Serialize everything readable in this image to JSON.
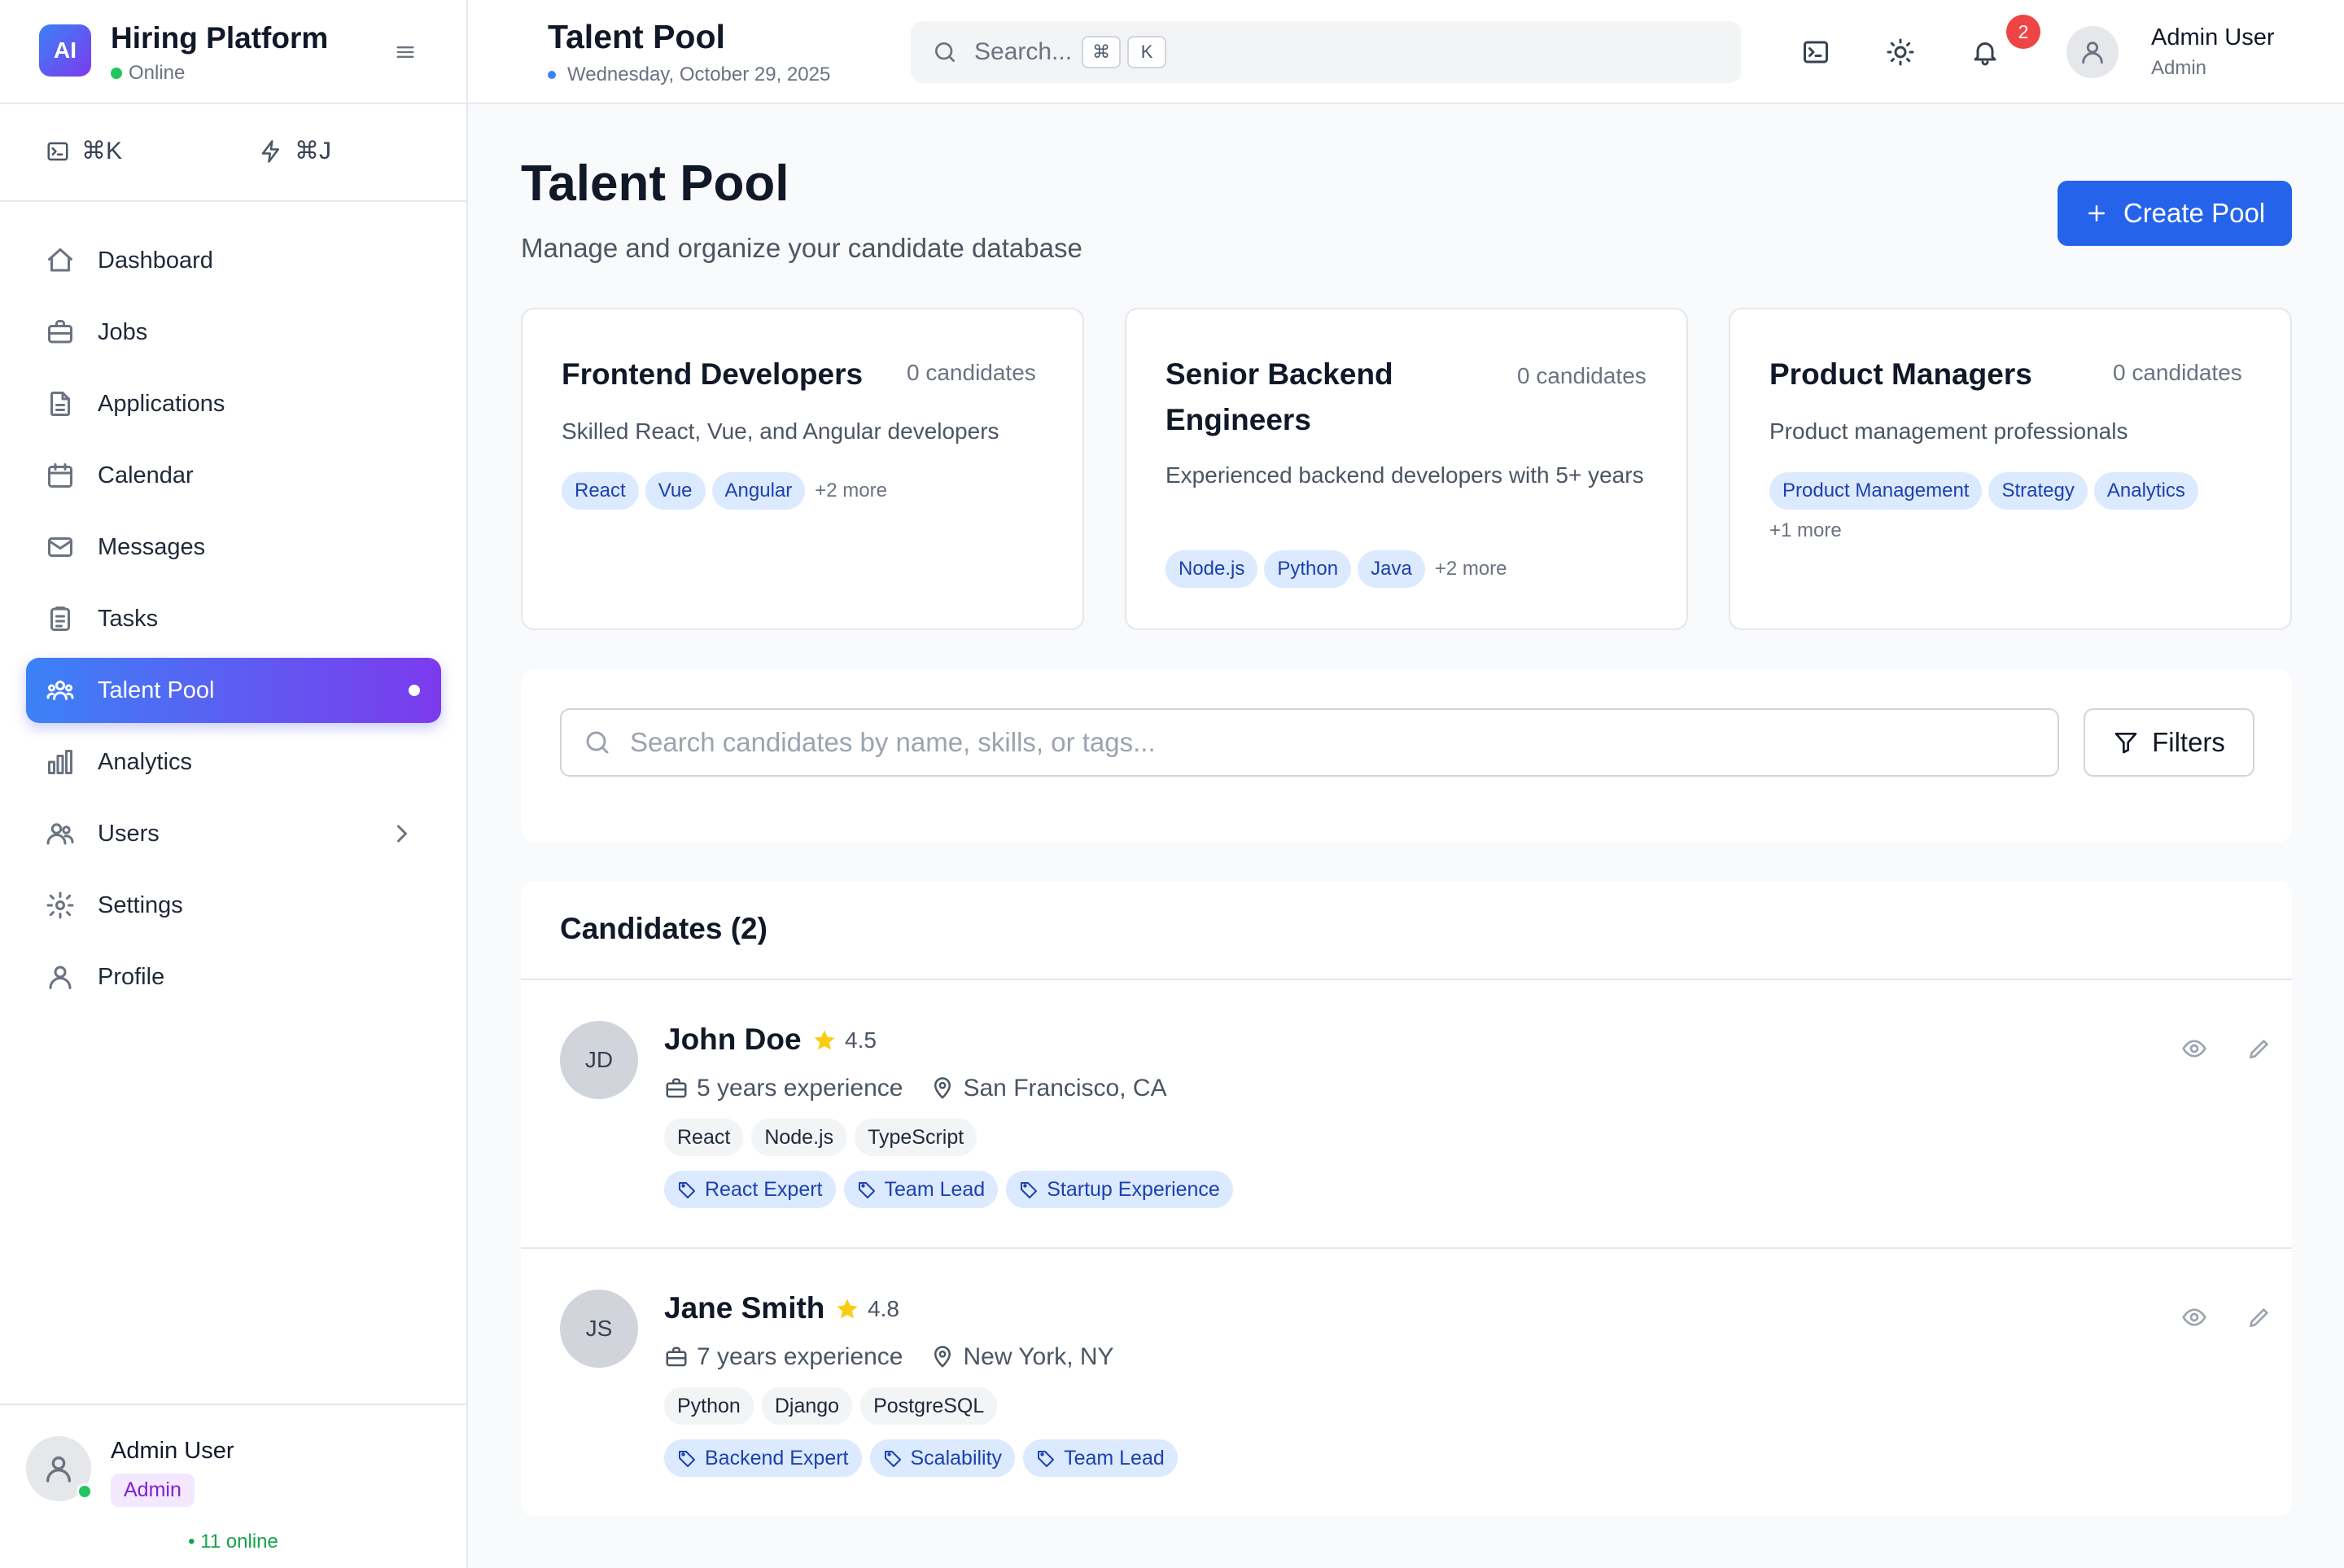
{
  "brand": {
    "logo_text": "AI",
    "name": "Hiring Platform",
    "status": "Online"
  },
  "shortcuts": [
    {
      "icon": "terminal-icon",
      "label": "⌘K"
    },
    {
      "icon": "lightning-icon",
      "label": "⌘J"
    }
  ],
  "nav": [
    {
      "label": "Dashboard",
      "icon": "home-icon"
    },
    {
      "label": "Jobs",
      "icon": "briefcase-icon"
    },
    {
      "label": "Applications",
      "icon": "document-icon"
    },
    {
      "label": "Calendar",
      "icon": "calendar-icon"
    },
    {
      "label": "Messages",
      "icon": "mail-icon"
    },
    {
      "label": "Tasks",
      "icon": "clipboard-icon"
    },
    {
      "label": "Talent Pool",
      "icon": "users-group-icon",
      "active": true
    },
    {
      "label": "Analytics",
      "icon": "bar-chart-icon"
    },
    {
      "label": "Users",
      "icon": "users-icon",
      "has_submenu": true
    },
    {
      "label": "Settings",
      "icon": "gear-icon"
    },
    {
      "label": "Profile",
      "icon": "user-icon"
    }
  ],
  "sidebar_footer": {
    "name": "Admin User",
    "role": "Admin",
    "online_text": "11 online"
  },
  "topbar": {
    "title": "Talent Pool",
    "date": "Wednesday, October 29, 2025",
    "search_placeholder": "Search...",
    "search_keys": [
      "⌘",
      "K"
    ],
    "notification_count": "2",
    "user_name": "Admin User",
    "user_role": "Admin"
  },
  "page": {
    "title": "Talent Pool",
    "subtitle": "Manage and organize your candidate database",
    "create_button": "Create Pool"
  },
  "pools": [
    {
      "title": "Frontend Developers",
      "count": "0 candidates",
      "description": "Skilled React, Vue, and Angular developers",
      "tags": [
        "React",
        "Vue",
        "Angular"
      ],
      "more": "+2 more"
    },
    {
      "title": "Senior Backend Engineers",
      "count": "0 candidates",
      "description": "Experienced backend developers with 5+ years",
      "tags": [
        "Node.js",
        "Python",
        "Java"
      ],
      "more": "+2 more"
    },
    {
      "title": "Product Managers",
      "count": "0 candidates",
      "description": "Product management professionals",
      "tags": [
        "Product Management",
        "Strategy",
        "Analytics"
      ],
      "more": "+1 more"
    }
  ],
  "candidate_search": {
    "placeholder": "Search candidates by name, skills, or tags...",
    "filters_label": "Filters"
  },
  "candidates_section": {
    "title": "Candidates (2)",
    "items": [
      {
        "initials": "JD",
        "name": "John Doe",
        "rating": "4.5",
        "experience": "5 years experience",
        "location": "San Francisco, CA",
        "skills": [
          "React",
          "Node.js",
          "TypeScript"
        ],
        "labels": [
          "React Expert",
          "Team Lead",
          "Startup Experience"
        ]
      },
      {
        "initials": "JS",
        "name": "Jane Smith",
        "rating": "4.8",
        "experience": "7 years experience",
        "location": "New York, NY",
        "skills": [
          "Python",
          "Django",
          "PostgreSQL"
        ],
        "labels": [
          "Backend Expert",
          "Scalability",
          "Team Lead"
        ]
      }
    ]
  },
  "colors": {
    "primary": "#2563eb",
    "active_gradient_start": "#3b82f6",
    "active_gradient_end": "#7c3aed",
    "online": "#22c55e",
    "notification": "#ef4444",
    "star": "#facc15",
    "tag_bg": "#dbeafe",
    "tag_text": "#1e40af"
  }
}
